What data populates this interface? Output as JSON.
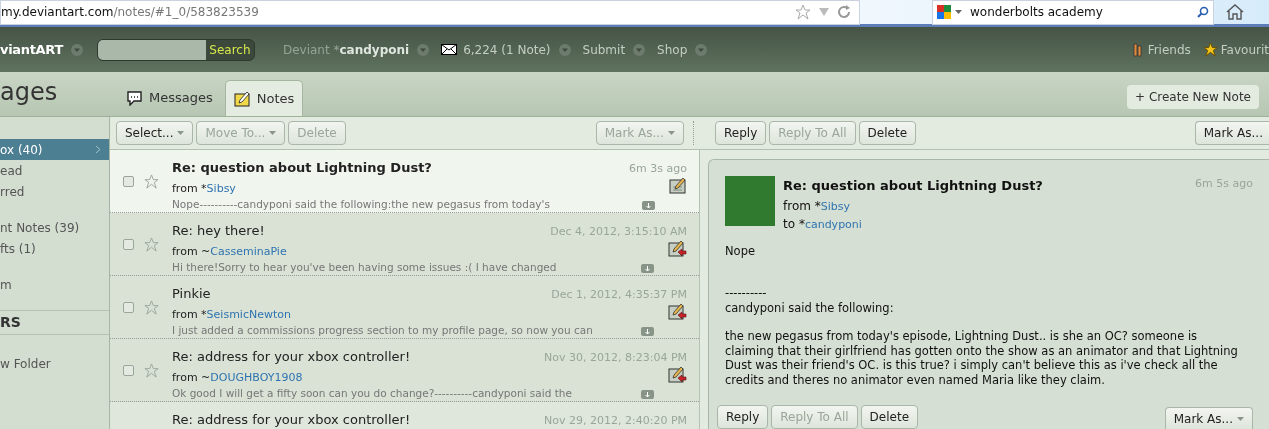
{
  "browser": {
    "url_host": "my.deviantart.com",
    "url_path": "/notes/#1_0/583823539",
    "search_value": "wonderbolts academy"
  },
  "nav": {
    "logo": "viantART",
    "search_button": "Search",
    "deviant_label": "Deviant ",
    "deviant_prefix": "*",
    "deviant_name": "candyponi",
    "messages": "6,224 (1 Note)",
    "submit": "Submit",
    "shop": "Shop",
    "friends": "Friends",
    "favourites": "Favourit"
  },
  "page_title": "ages",
  "tabs": [
    {
      "label": "Messages",
      "selected": false
    },
    {
      "label": "Notes",
      "selected": true
    }
  ],
  "create_button": "+ Create New Note",
  "sidebar": {
    "items": [
      {
        "label": "ox (40)",
        "selected": true
      },
      {
        "label": "ead",
        "selected": false
      },
      {
        "label": "rred",
        "selected": false
      },
      {
        "label": "nt Notes (39)",
        "selected": false
      },
      {
        "label": "fts (1)",
        "selected": false
      },
      {
        "label": "m",
        "selected": false
      }
    ],
    "section": "RS",
    "folder_items": [
      {
        "label": "w Folder",
        "selected": false
      }
    ]
  },
  "list_toolbar": [
    {
      "label": "Select...",
      "disabled": false,
      "dropdown": true
    },
    {
      "label": "Move To...",
      "disabled": true,
      "dropdown": true
    },
    {
      "label": "Delete",
      "disabled": true,
      "dropdown": false
    }
  ],
  "list_mark_as": {
    "label": "Mark As...",
    "disabled": true
  },
  "notes": [
    {
      "subject": "Re: question about Lightning Dust?",
      "unread": true,
      "selected": true,
      "from_label": "from ",
      "from_prefix": "*",
      "from": "Sibsy",
      "preview": "Nope----------candyponi said the following:the new pegasus from today's",
      "date": "6m 3s ago",
      "kind": "note"
    },
    {
      "subject": "Re: hey there!",
      "unread": false,
      "selected": false,
      "from_label": "from ",
      "from_prefix": "~",
      "from": "CasseminaPie",
      "preview": "Hi there!Sorry to hear you've been having some issues :( I have changed",
      "date": "Dec 4, 2012, 3:15:10 AM",
      "kind": "replied"
    },
    {
      "subject": "Pinkie",
      "unread": false,
      "selected": false,
      "from_label": "from ",
      "from_prefix": "*",
      "from": "SeismicNewton",
      "preview": "I just added a commissions progress section to my profile page, so now you can",
      "date": "Dec 1, 2012, 4:35:37 PM",
      "kind": "replied"
    },
    {
      "subject": "Re: address for your xbox controller!",
      "unread": false,
      "selected": false,
      "from_label": "from ",
      "from_prefix": "~",
      "from": "DOUGHBOY1908",
      "preview": "Ok good I will get a fifty soon can you do change?----------candyponi said the",
      "date": "Nov 30, 2012, 8:23:04 PM",
      "kind": "replied"
    }
  ],
  "last_note": {
    "subject": "Re: address for your xbox controller!",
    "date": "Nov 29, 2012, 2:40:20 PM"
  },
  "detail_toolbar": [
    {
      "label": "Reply",
      "disabled": false
    },
    {
      "label": "Reply To All",
      "disabled": true
    },
    {
      "label": "Delete",
      "disabled": false
    }
  ],
  "detail_mark_as": "Mark As...",
  "detail": {
    "subject": "Re: question about Lightning Dust?",
    "from_label": "from ",
    "from_prefix": "*",
    "from": "Sibsy",
    "to_label": "to ",
    "to_prefix": "*",
    "to": "candyponi",
    "date": "6m 5s ago",
    "body": [
      [
        "Nope"
      ],
      [
        "----------",
        "candyponi said the following:"
      ],
      [
        "the new pegasus from today's episode, Lightning Dust.. is she an OC? someone is claiming that their girlfriend has gotten onto the show as an animator and that Lightning Dust was their friend's OC. is this true? i simply can't believe this as i've check all the credits and theres no animator even named Maria like they claim."
      ]
    ]
  },
  "detail_bottom_toolbar": [
    {
      "label": "Reply",
      "disabled": false
    },
    {
      "label": "Reply To All",
      "disabled": true
    },
    {
      "label": "Delete",
      "disabled": false
    }
  ],
  "detail_bottom_mark_as": "Mark As..."
}
